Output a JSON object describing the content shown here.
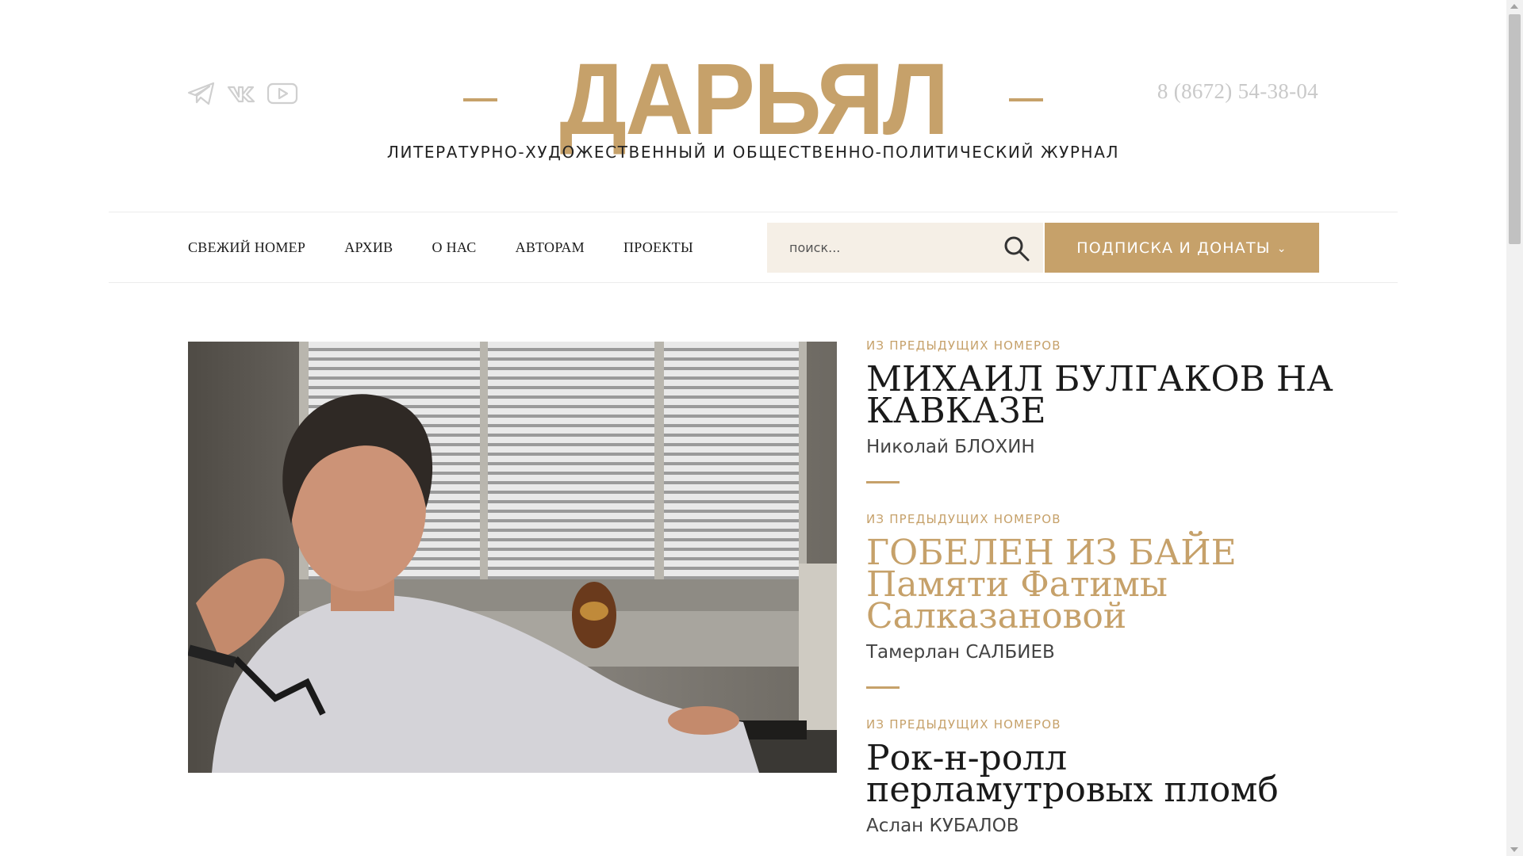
{
  "header": {
    "logo": "ДАРЬЯЛ",
    "tagline": "ЛИТЕРАТУРНО-ХУДОЖЕСТВЕННЫЙ И ОБЩЕСТВЕННО-ПОЛИТИЧЕСКИЙ ЖУРНАЛ",
    "phone": "8 (8672) 54-38-04",
    "social_icons": [
      "telegram-icon",
      "vk-icon",
      "youtube-icon"
    ]
  },
  "nav": {
    "items": [
      {
        "label": "СВЕЖИЙ НОМЕР"
      },
      {
        "label": "АРХИВ"
      },
      {
        "label": "О НАС"
      },
      {
        "label": "АВТОРАМ"
      },
      {
        "label": "ПРОЕКТЫ"
      }
    ],
    "search_placeholder": "поиск...",
    "subscribe_label": "ПОДПИСКА И ДОНАТЫ",
    "subscribe_icon": "chevron-down-icon"
  },
  "articles": [
    {
      "kicker": "ИЗ ПРЕДЫДУЩИХ НОМЕРОВ",
      "title": "МИХАИЛ БУЛГАКОВ НА КАВКАЗЕ",
      "author": "Николай БЛОХИН"
    },
    {
      "kicker": "ИЗ ПРЕДЫДУЩИХ НОМЕРОВ",
      "title": "ГОБЕЛЕН ИЗ БАЙЕ Памяти Фатимы Салказановой",
      "author": "Тамерлан САЛБИЕВ"
    },
    {
      "kicker": "ИЗ ПРЕДЫДУЩИХ НОМЕРОВ",
      "title": "Рок-н-ролл перламутровых пломб",
      "author": "Аслан КУБАЛОВ"
    }
  ],
  "colors": {
    "accent": "#c6a16a",
    "search_bg": "#f5efe6",
    "phone": "#c9c9c9"
  }
}
